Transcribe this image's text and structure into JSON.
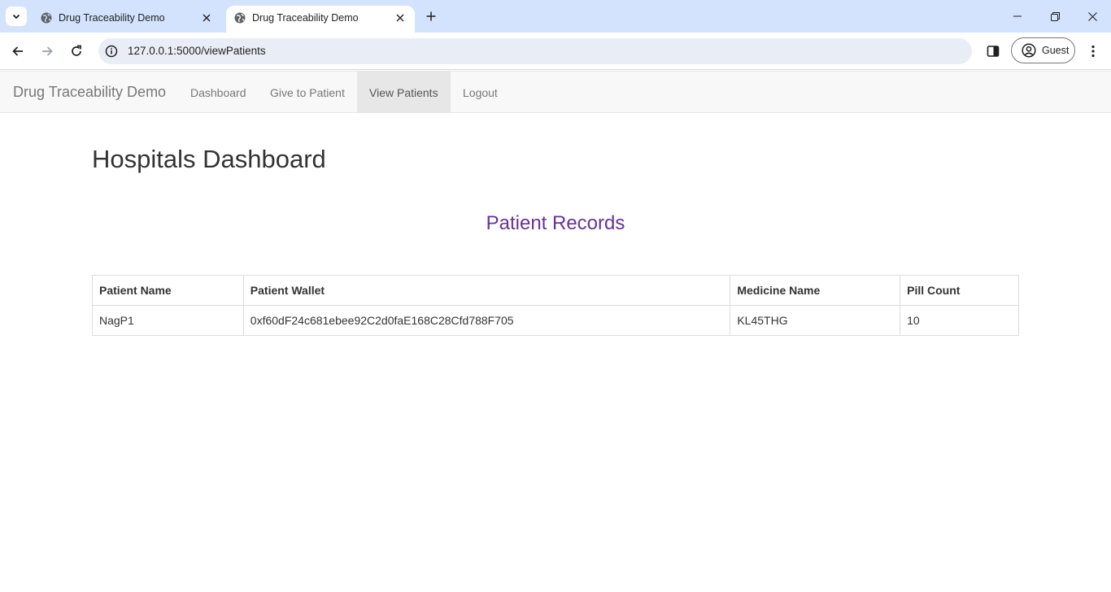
{
  "browser": {
    "tabs": [
      {
        "title": "Drug Traceability Demo",
        "active": false
      },
      {
        "title": "Drug Traceability Demo",
        "active": true
      }
    ],
    "url": "127.0.0.1:5000/viewPatients",
    "profile_label": "Guest"
  },
  "navbar": {
    "brand": "Drug Traceability Demo",
    "items": [
      {
        "label": "Dashboard",
        "active": false
      },
      {
        "label": "Give to Patient",
        "active": false
      },
      {
        "label": "View Patients",
        "active": true
      },
      {
        "label": "Logout",
        "active": false
      }
    ]
  },
  "main": {
    "page_title": "Hospitals Dashboard",
    "section_title": "Patient Records",
    "table": {
      "headers": [
        "Patient Name",
        "Patient Wallet",
        "Medicine Name",
        "Pill Count"
      ],
      "rows": [
        [
          "NagP1",
          "0xf60dF24c681ebee92C2d0faE168C28Cfd788F705",
          "KL45THG",
          "10"
        ]
      ]
    }
  },
  "colors": {
    "tabstrip": "#d3e3fd",
    "omnibox": "#e9eef6",
    "navbar_bg": "#f8f8f8",
    "active_nav": "#e7e7e7",
    "section_title": "#663399"
  }
}
